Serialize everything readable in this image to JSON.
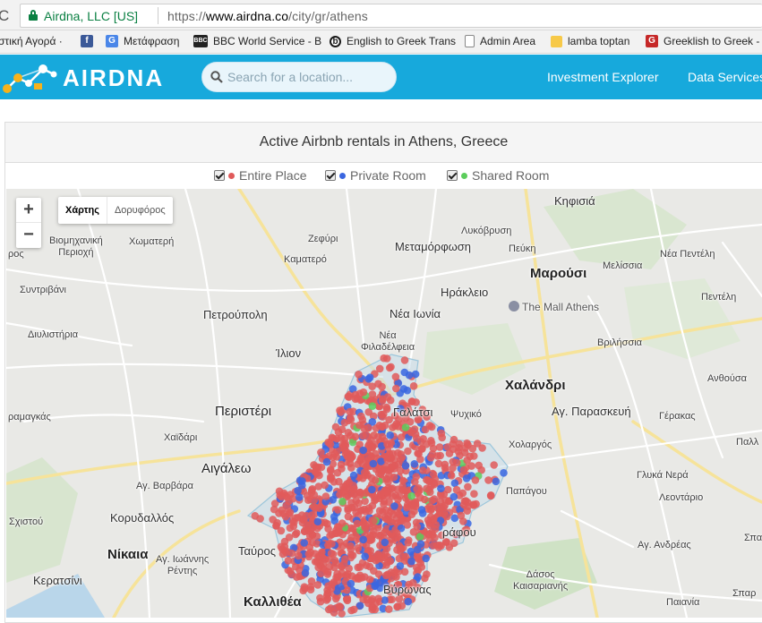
{
  "browser": {
    "site_identity": "Airdna, LLC [US]",
    "url": {
      "scheme": "https://",
      "host": "www.airdna.co",
      "path": "/city/gr/athens"
    },
    "bookmarks": [
      {
        "label": "στική Αγορά ·",
        "icon": "none"
      },
      {
        "label": "",
        "icon": "facebook-icon"
      },
      {
        "label": "Μετάφραση",
        "icon": "google-translate-icon"
      },
      {
        "label": "BBC World Service - B",
        "icon": "bbc-icon"
      },
      {
        "label": "English to Greek Trans",
        "icon": "bing-icon"
      },
      {
        "label": "Admin Area",
        "icon": "page-icon"
      },
      {
        "label": "lamba toptan",
        "icon": "folder-icon"
      },
      {
        "label": "Greeklish to Greek -",
        "icon": "g-icon"
      }
    ]
  },
  "header": {
    "logo_text": "AIRDNA",
    "search_placeholder": "Search for a location...",
    "nav": [
      "Investment Explorer",
      "Data Services"
    ]
  },
  "panel": {
    "title": "Active Airbnb rentals in Athens, Greece",
    "filters": [
      {
        "label": "Entire Place",
        "color": "#e05a5a",
        "checked": true
      },
      {
        "label": "Private Room",
        "color": "#3a66e0",
        "checked": true
      },
      {
        "label": "Shared Room",
        "color": "#5ccd5c",
        "checked": true
      }
    ]
  },
  "map": {
    "zoom_in": "+",
    "zoom_out": "−",
    "map_types": [
      "Χάρτης",
      "Δορυφόρος"
    ],
    "labels": {
      "kifisia": "Κηφισιά",
      "lykovrysi": "Λυκόβρυση",
      "pefki": "Πεύκη",
      "zefyri": "Ζεφύρι",
      "metamorfosi": "Μεταμόρφωση",
      "kamatero": "Καματερό",
      "marousi": "Μαρούσι",
      "melissia": "Μελίσσια",
      "nea_penteli": "Νέα Πεντέλη",
      "penteli": "Πεντέλη",
      "irakleio": "Ηράκλειο",
      "vioskoniki": "Βιομηχανική\nΠεριοχή",
      "chomateri": "Χωματερή",
      "ros": "ρος",
      "syntrivani": "Συντριβάνι",
      "petroupoli": "Πετρούπολη",
      "nea_ionia": "Νέα Ιωνία",
      "mall": "The Mall Athens",
      "diylistiria": "Διυλιστήρια",
      "nea_filadelfeia": "Νέα\nΦιλαδέλφεια",
      "vrilissia": "Βριλήσσια",
      "ilion": "Ίλιον",
      "anthousa": "Ανθούσα",
      "chalandri": "Χαλάνδρι",
      "ramagkas": "ραμαγκάς",
      "peristeri": "Περιστέρι",
      "galatsi": "Γαλάτσι",
      "psychiko": "Ψυχικό",
      "ag_paraskevi": "Αγ. Παρασκευή",
      "gerakas": "Γέρακας",
      "chaidari": "Χαϊδάρι",
      "cholargos": "Χολαργός",
      "palli": "Παλλ",
      "aigaleo": "Αιγάλεω",
      "glyka_nera": "Γλυκά Νερά",
      "ag_varvara": "Αγ. Βαρβάρα",
      "papagou": "Παπάγου",
      "leontario": "Λεοντάριο",
      "sxistou": "Σχιστού",
      "korydallos": "Κορυδαλλός",
      "ag_andreas": "Αγ. Ανδρέας",
      "zografou": "ράφου",
      "spata": "Σπατ",
      "nikaia": "Νίκαια",
      "ag_ioannis": "Αγ. Ιωάννης\nΡέντης",
      "tavros": "Ταύρος",
      "dasos": "Δάσος\nΚαισαριανής",
      "keratsini": "Κερατσίνι",
      "vyronas": "Βύρωνας",
      "kallithea": "Καλλιθέα",
      "paiania": "Παιανία",
      "sparo": "Σπαρ"
    }
  }
}
